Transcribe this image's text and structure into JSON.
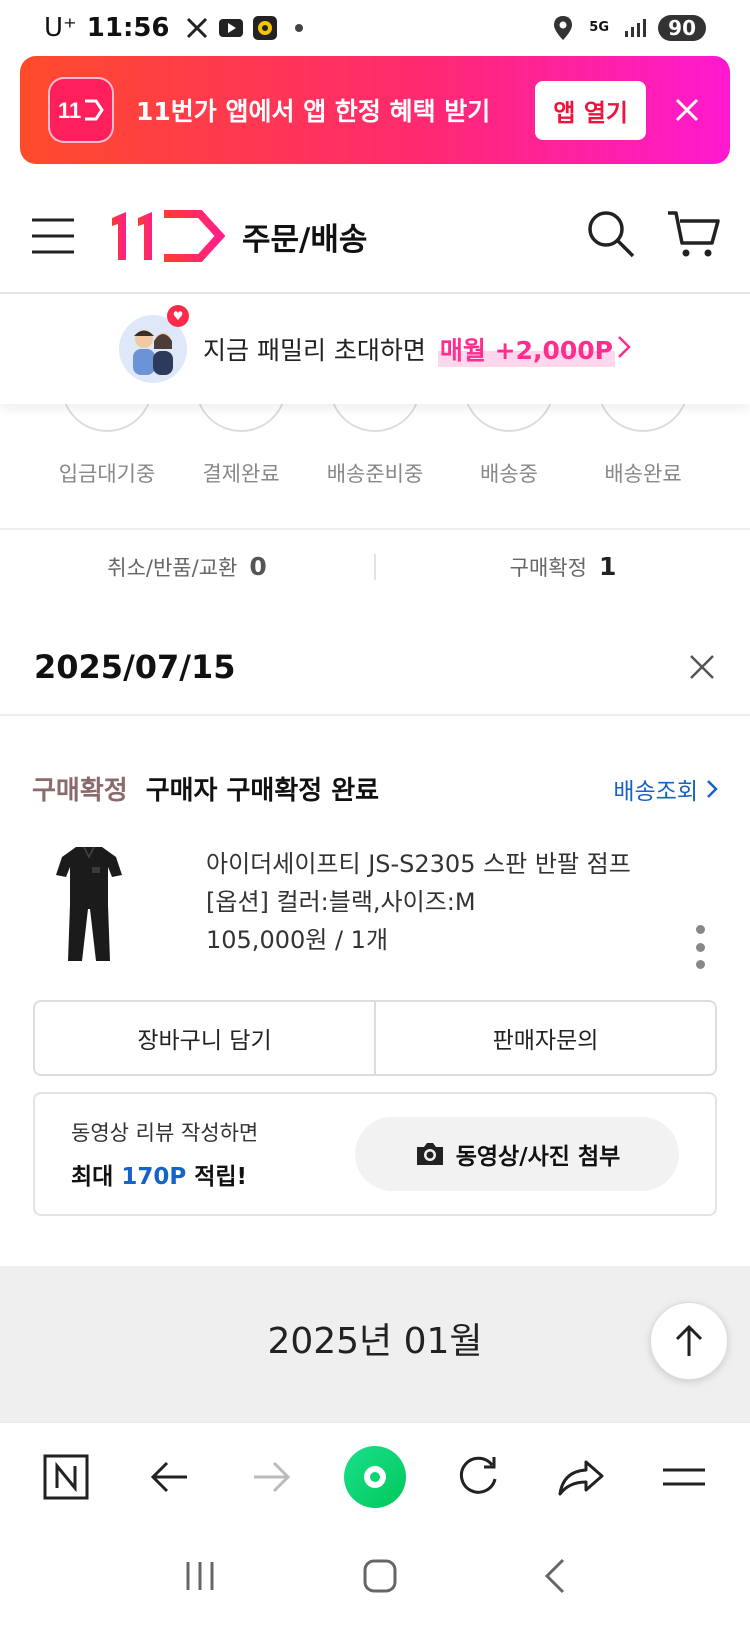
{
  "status_bar": {
    "carrier": "U⁺",
    "time": "11:56",
    "battery": "90",
    "network": "5G"
  },
  "promo": {
    "logo": "11",
    "text": "11번가 앱에서 앱 한정 혜택 받기",
    "button": "앱 열기"
  },
  "header": {
    "title": "주문/배송"
  },
  "family": {
    "text": "지금 패밀리 초대하면",
    "accent": "매월 +2,000P"
  },
  "steps": [
    "입금대기중",
    "결제완료",
    "배송준비중",
    "배송중",
    "배송완료"
  ],
  "counts": {
    "cancel_label": "취소/반품/교환",
    "cancel_value": "0",
    "confirm_label": "구매확정",
    "confirm_value": "1"
  },
  "order": {
    "date": "2025/07/15",
    "status_label": "구매확정",
    "status_desc": "구매자 구매확정 완료",
    "track_link": "배송조회",
    "product_name": "아이더세이프티 JS-S2305 스판 반팔 점프",
    "product_option": "[옵션] 컬러:블랙,사이즈:M",
    "product_price": "105,000원 / 1개",
    "btn_cart": "장바구니 담기",
    "btn_inquiry": "판매자문의"
  },
  "review": {
    "line1": "동영상 리뷰 작성하면",
    "line2_prefix": "최대 ",
    "line2_accent": "170P",
    "line2_suffix": " 적립!",
    "button": "동영상/사진 첨부"
  },
  "month": "2025년 01월",
  "colors": {
    "brand": "#ff1f5a",
    "accent_blue": "#1663c7",
    "accent_pink": "#ff2d8e"
  }
}
